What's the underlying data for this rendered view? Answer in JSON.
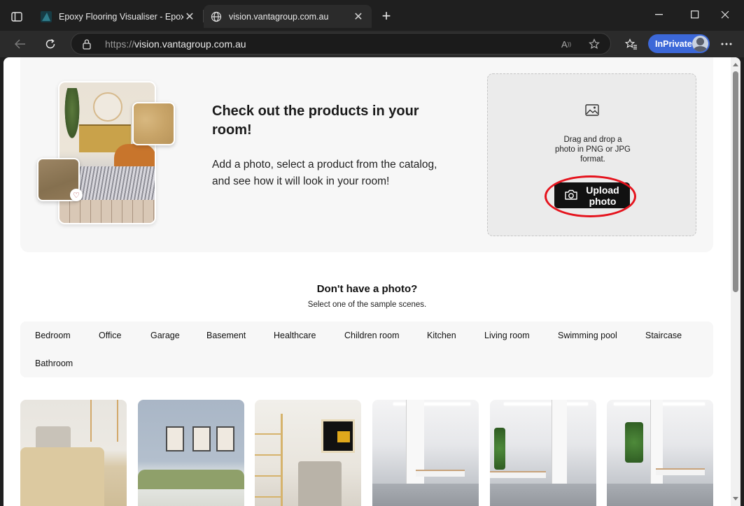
{
  "browser": {
    "tabs": [
      {
        "title": "Epoxy Flooring Visualiser - Epoxy",
        "active": false
      },
      {
        "title": "vision.vantagroup.com.au",
        "active": true
      }
    ],
    "address": {
      "protocol": "https://",
      "host": "vision.vantagroup.com.au"
    },
    "inprivate_label": "InPrivate",
    "accent_color": "#3c68d8"
  },
  "hero": {
    "title": "Check out the products in your room!",
    "description": "Add a photo, select a product from the catalog, and see how it will look in your room!",
    "dropzone_text": "Drag and drop a photo in PNG or JPG format.",
    "upload_button": "Upload photo",
    "highlight_color": "#e5131d"
  },
  "samples": {
    "title": "Don't have a photo?",
    "subtitle": "Select one of the sample scenes.",
    "scenes": [
      "Bedroom",
      "Office",
      "Garage",
      "Basement",
      "Healthcare",
      "Children room",
      "Kitchen",
      "Living room",
      "Swimming pool",
      "Staircase",
      "Bathroom"
    ],
    "thumbnails": [
      "bedroom-scene-1",
      "bedroom-scene-2",
      "bedroom-scene-3",
      "office-scene-1",
      "office-scene-2",
      "office-scene-3"
    ]
  }
}
